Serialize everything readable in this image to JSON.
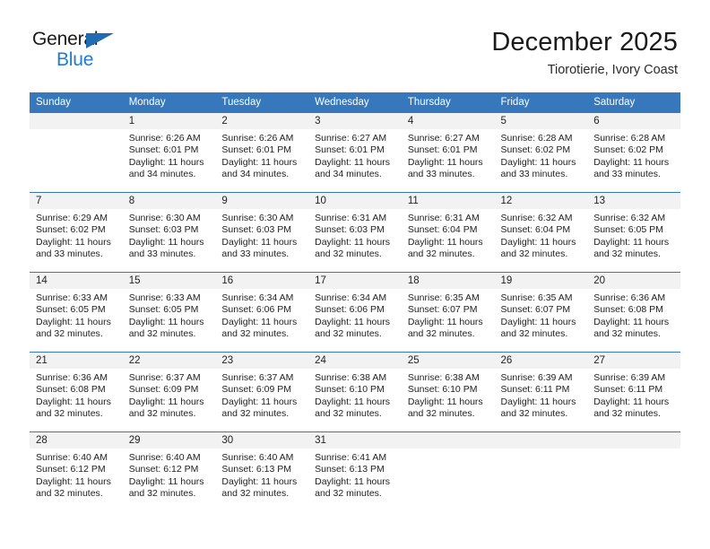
{
  "brand": {
    "name_part1": "General",
    "name_part2": "Blue",
    "accent_color": "#1f7dd0",
    "triangle_color": "#1f6cb4"
  },
  "header": {
    "title": "December 2025",
    "subtitle": "Tiorotierie, Ivory Coast"
  },
  "theme": {
    "header_blue": "#3778bc",
    "daynum_band": "#f2f2f2",
    "text": "#222222"
  },
  "weekdays": [
    "Sunday",
    "Monday",
    "Tuesday",
    "Wednesday",
    "Thursday",
    "Friday",
    "Saturday"
  ],
  "weeks": [
    [
      {
        "day": "",
        "sunrise": "",
        "sunset": "",
        "daylight": ""
      },
      {
        "day": "1",
        "sunrise": "Sunrise: 6:26 AM",
        "sunset": "Sunset: 6:01 PM",
        "daylight": "Daylight: 11 hours and 34 minutes."
      },
      {
        "day": "2",
        "sunrise": "Sunrise: 6:26 AM",
        "sunset": "Sunset: 6:01 PM",
        "daylight": "Daylight: 11 hours and 34 minutes."
      },
      {
        "day": "3",
        "sunrise": "Sunrise: 6:27 AM",
        "sunset": "Sunset: 6:01 PM",
        "daylight": "Daylight: 11 hours and 34 minutes."
      },
      {
        "day": "4",
        "sunrise": "Sunrise: 6:27 AM",
        "sunset": "Sunset: 6:01 PM",
        "daylight": "Daylight: 11 hours and 33 minutes."
      },
      {
        "day": "5",
        "sunrise": "Sunrise: 6:28 AM",
        "sunset": "Sunset: 6:02 PM",
        "daylight": "Daylight: 11 hours and 33 minutes."
      },
      {
        "day": "6",
        "sunrise": "Sunrise: 6:28 AM",
        "sunset": "Sunset: 6:02 PM",
        "daylight": "Daylight: 11 hours and 33 minutes."
      }
    ],
    [
      {
        "day": "7",
        "sunrise": "Sunrise: 6:29 AM",
        "sunset": "Sunset: 6:02 PM",
        "daylight": "Daylight: 11 hours and 33 minutes."
      },
      {
        "day": "8",
        "sunrise": "Sunrise: 6:30 AM",
        "sunset": "Sunset: 6:03 PM",
        "daylight": "Daylight: 11 hours and 33 minutes."
      },
      {
        "day": "9",
        "sunrise": "Sunrise: 6:30 AM",
        "sunset": "Sunset: 6:03 PM",
        "daylight": "Daylight: 11 hours and 33 minutes."
      },
      {
        "day": "10",
        "sunrise": "Sunrise: 6:31 AM",
        "sunset": "Sunset: 6:03 PM",
        "daylight": "Daylight: 11 hours and 32 minutes."
      },
      {
        "day": "11",
        "sunrise": "Sunrise: 6:31 AM",
        "sunset": "Sunset: 6:04 PM",
        "daylight": "Daylight: 11 hours and 32 minutes."
      },
      {
        "day": "12",
        "sunrise": "Sunrise: 6:32 AM",
        "sunset": "Sunset: 6:04 PM",
        "daylight": "Daylight: 11 hours and 32 minutes."
      },
      {
        "day": "13",
        "sunrise": "Sunrise: 6:32 AM",
        "sunset": "Sunset: 6:05 PM",
        "daylight": "Daylight: 11 hours and 32 minutes."
      }
    ],
    [
      {
        "day": "14",
        "sunrise": "Sunrise: 6:33 AM",
        "sunset": "Sunset: 6:05 PM",
        "daylight": "Daylight: 11 hours and 32 minutes."
      },
      {
        "day": "15",
        "sunrise": "Sunrise: 6:33 AM",
        "sunset": "Sunset: 6:05 PM",
        "daylight": "Daylight: 11 hours and 32 minutes."
      },
      {
        "day": "16",
        "sunrise": "Sunrise: 6:34 AM",
        "sunset": "Sunset: 6:06 PM",
        "daylight": "Daylight: 11 hours and 32 minutes."
      },
      {
        "day": "17",
        "sunrise": "Sunrise: 6:34 AM",
        "sunset": "Sunset: 6:06 PM",
        "daylight": "Daylight: 11 hours and 32 minutes."
      },
      {
        "day": "18",
        "sunrise": "Sunrise: 6:35 AM",
        "sunset": "Sunset: 6:07 PM",
        "daylight": "Daylight: 11 hours and 32 minutes."
      },
      {
        "day": "19",
        "sunrise": "Sunrise: 6:35 AM",
        "sunset": "Sunset: 6:07 PM",
        "daylight": "Daylight: 11 hours and 32 minutes."
      },
      {
        "day": "20",
        "sunrise": "Sunrise: 6:36 AM",
        "sunset": "Sunset: 6:08 PM",
        "daylight": "Daylight: 11 hours and 32 minutes."
      }
    ],
    [
      {
        "day": "21",
        "sunrise": "Sunrise: 6:36 AM",
        "sunset": "Sunset: 6:08 PM",
        "daylight": "Daylight: 11 hours and 32 minutes."
      },
      {
        "day": "22",
        "sunrise": "Sunrise: 6:37 AM",
        "sunset": "Sunset: 6:09 PM",
        "daylight": "Daylight: 11 hours and 32 minutes."
      },
      {
        "day": "23",
        "sunrise": "Sunrise: 6:37 AM",
        "sunset": "Sunset: 6:09 PM",
        "daylight": "Daylight: 11 hours and 32 minutes."
      },
      {
        "day": "24",
        "sunrise": "Sunrise: 6:38 AM",
        "sunset": "Sunset: 6:10 PM",
        "daylight": "Daylight: 11 hours and 32 minutes."
      },
      {
        "day": "25",
        "sunrise": "Sunrise: 6:38 AM",
        "sunset": "Sunset: 6:10 PM",
        "daylight": "Daylight: 11 hours and 32 minutes."
      },
      {
        "day": "26",
        "sunrise": "Sunrise: 6:39 AM",
        "sunset": "Sunset: 6:11 PM",
        "daylight": "Daylight: 11 hours and 32 minutes."
      },
      {
        "day": "27",
        "sunrise": "Sunrise: 6:39 AM",
        "sunset": "Sunset: 6:11 PM",
        "daylight": "Daylight: 11 hours and 32 minutes."
      }
    ],
    [
      {
        "day": "28",
        "sunrise": "Sunrise: 6:40 AM",
        "sunset": "Sunset: 6:12 PM",
        "daylight": "Daylight: 11 hours and 32 minutes."
      },
      {
        "day": "29",
        "sunrise": "Sunrise: 6:40 AM",
        "sunset": "Sunset: 6:12 PM",
        "daylight": "Daylight: 11 hours and 32 minutes."
      },
      {
        "day": "30",
        "sunrise": "Sunrise: 6:40 AM",
        "sunset": "Sunset: 6:13 PM",
        "daylight": "Daylight: 11 hours and 32 minutes."
      },
      {
        "day": "31",
        "sunrise": "Sunrise: 6:41 AM",
        "sunset": "Sunset: 6:13 PM",
        "daylight": "Daylight: 11 hours and 32 minutes."
      },
      {
        "day": "",
        "sunrise": "",
        "sunset": "",
        "daylight": ""
      },
      {
        "day": "",
        "sunrise": "",
        "sunset": "",
        "daylight": ""
      },
      {
        "day": "",
        "sunrise": "",
        "sunset": "",
        "daylight": ""
      }
    ]
  ]
}
